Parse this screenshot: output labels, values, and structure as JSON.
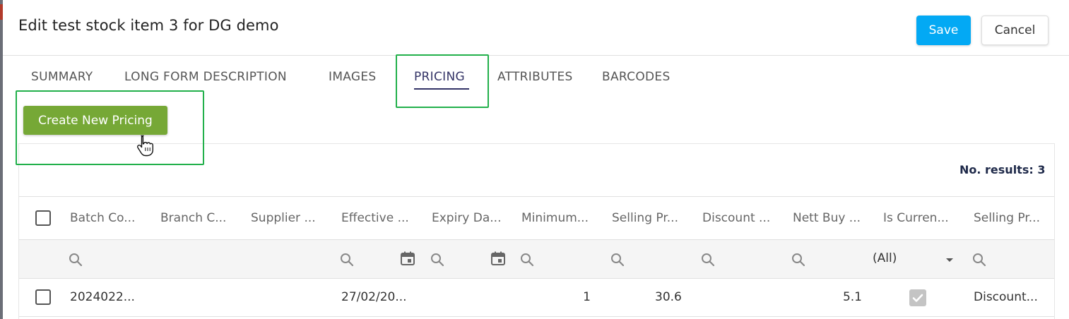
{
  "dialog": {
    "title": "Edit test stock item 3 for DG demo",
    "save_label": "Save",
    "cancel_label": "Cancel",
    "accent_color": "#03a9f4",
    "highlight_color": "#22b04b"
  },
  "tabs": [
    {
      "label": "SUMMARY"
    },
    {
      "label": "LONG FORM DESCRIPTION"
    },
    {
      "label": "IMAGES"
    },
    {
      "label": "PRICING",
      "active": true
    },
    {
      "label": "ATTRIBUTES"
    },
    {
      "label": "BARCODES"
    }
  ],
  "pricing": {
    "create_label": "Create New Pricing",
    "create_color": "#76a836",
    "results_label": "No. results: 3",
    "columns": [
      "Batch Co...",
      "Branch C...",
      "Supplier ...",
      "Effective ...",
      "Expiry Da...",
      "Minimum...",
      "Selling Pr...",
      "Discount ...",
      "Nett Buy ...",
      "Is Curren...",
      "Selling Pr..."
    ],
    "filter_select_value": "(All)",
    "rows": [
      {
        "batch_code": "2024022...",
        "effective": "27/02/20...",
        "minimum": "1",
        "selling_price": "30.6",
        "nett_buy": "5.1",
        "is_current": true,
        "selling_type": "Discount..."
      }
    ]
  }
}
